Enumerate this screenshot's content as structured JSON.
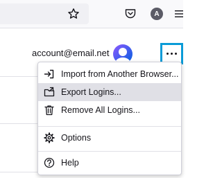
{
  "toolbar": {
    "star_icon": "star-icon",
    "pocket_icon": "pocket-icon",
    "account_initial": "A",
    "app_menu_icon": "hamburger-icon"
  },
  "account": {
    "email": "account@email.net",
    "avatar_icon": "user-avatar-icon",
    "more_button_icon": "ellipsis-icon",
    "highlight_color": "#0a9bd7"
  },
  "menu": {
    "items": [
      {
        "label": "Import from Another Browser...",
        "icon": "import-icon"
      },
      {
        "label": "Export Logins...",
        "icon": "export-folder-icon",
        "highlighted": true
      },
      {
        "label": "Remove All Logins...",
        "icon": "trash-icon"
      },
      {
        "label": "Options",
        "icon": "gear-icon"
      },
      {
        "label": "Help",
        "icon": "help-icon"
      }
    ]
  }
}
